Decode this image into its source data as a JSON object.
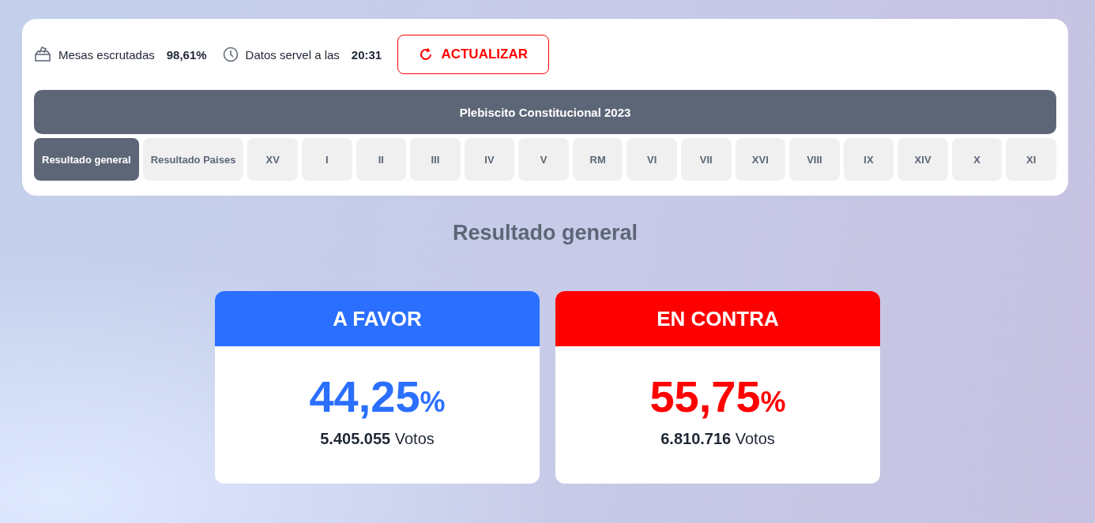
{
  "status": {
    "tables_label": "Mesas escrutadas",
    "tables_value": "98,61%",
    "time_label": "Datos servel a las",
    "time_value": "20:31"
  },
  "refresh_button": "ACTUALIZAR",
  "election_title": "Plebiscito Constitucional 2023",
  "tabs": [
    {
      "label": "Resultado general",
      "selected": true
    },
    {
      "label": "Resultado Paises",
      "selected": false
    },
    {
      "label": "XV",
      "selected": false
    },
    {
      "label": "I",
      "selected": false
    },
    {
      "label": "II",
      "selected": false
    },
    {
      "label": "III",
      "selected": false
    },
    {
      "label": "IV",
      "selected": false
    },
    {
      "label": "V",
      "selected": false
    },
    {
      "label": "RM",
      "selected": false
    },
    {
      "label": "VI",
      "selected": false
    },
    {
      "label": "VII",
      "selected": false
    },
    {
      "label": "XVI",
      "selected": false
    },
    {
      "label": "VIII",
      "selected": false
    },
    {
      "label": "IX",
      "selected": false
    },
    {
      "label": "XIV",
      "selected": false
    },
    {
      "label": "X",
      "selected": false
    },
    {
      "label": "XI",
      "selected": false
    }
  ],
  "section_title": "Resultado general",
  "options": [
    {
      "name": "A FAVOR",
      "color": "#2b6fff",
      "percent": "44,25",
      "unit": "%",
      "votes": "**5.405.055** Votos"
    },
    {
      "name": "EN CONTRA",
      "color": "#ff0000",
      "percent": "55,75",
      "unit": "%",
      "votes": "**6.810.716** Votos"
    }
  ]
}
